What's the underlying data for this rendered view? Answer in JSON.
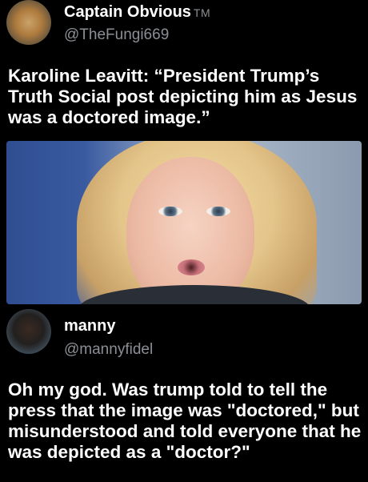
{
  "post1": {
    "display_name": "Captain Obvious",
    "name_suffix": "TM",
    "handle": "@TheFungi669",
    "text": "Karoline Leavitt: “President Trump’s Truth Social post depicting him as Jesus was a doctored image.”"
  },
  "post2": {
    "display_name": "manny",
    "handle": "@mannyfidel",
    "text": "Oh my god. Was trump told to tell the press that the image was \"doctored,\" but misunderstood and told everyone that he was depicted as a \"doctor?\""
  }
}
